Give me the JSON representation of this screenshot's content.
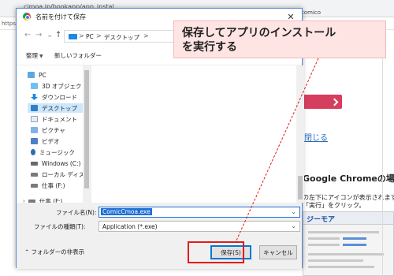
{
  "browser": {
    "url": "cimoa.jp/bookapp/app_instal",
    "url_prefix": "https://cr",
    "right_tab_text": "comico"
  },
  "webpage": {
    "link_text": "閉じる",
    "heading": "Google Chromeの場合",
    "note_line1": "の左下にアイコンが表示されます",
    "note_line2": "「実行」をクリック。",
    "thumb_logo": "ジーモア"
  },
  "dialog": {
    "title": "名前を付けて保存",
    "close": "✕",
    "nav": {
      "back": "←",
      "forward": "→",
      "up": "↑"
    },
    "address": {
      "segments": [
        "PC",
        "デスクトップ"
      ],
      "chevron": ">"
    },
    "refresh": "↻",
    "toolbar": {
      "organize": "整理",
      "new_folder": "新しいフォルダー"
    },
    "sidebar": {
      "items": [
        {
          "label": "PC",
          "icon": "pc-icon"
        },
        {
          "label": "3D オブジェクト",
          "icon": "3d-objects-icon"
        },
        {
          "label": "ダウンロード",
          "icon": "download-icon"
        },
        {
          "label": "デスクトップ",
          "icon": "desktop-icon",
          "selected": true
        },
        {
          "label": "ドキュメント",
          "icon": "documents-icon"
        },
        {
          "label": "ピクチャ",
          "icon": "pictures-icon"
        },
        {
          "label": "ビデオ",
          "icon": "videos-icon"
        },
        {
          "label": "ミュージック",
          "icon": "music-icon"
        },
        {
          "label": "Windows (C:)",
          "icon": "windows-drive-icon"
        },
        {
          "label": "ローカル ディスク (D",
          "icon": "local-disk-icon"
        },
        {
          "label": "仕事 (F:)",
          "icon": "drive-icon"
        },
        {
          "label": "仕事 (F:)",
          "icon": "drive-icon"
        }
      ]
    },
    "file_name": {
      "label": "ファイル名(N):",
      "value": "ComicCmoa.exe"
    },
    "file_type": {
      "label": "ファイルの種類(T):",
      "value": "Application (*.exe)"
    },
    "hide_folders": "フォルダーの非表示",
    "save_button": "保存(S)",
    "cancel_button": "キャンセル"
  },
  "callout": {
    "line1": "保存してアプリのインストール",
    "line2": "を実行する",
    "colors": {
      "background": "#ffe4e4",
      "highlight": "#e21b1b"
    }
  }
}
